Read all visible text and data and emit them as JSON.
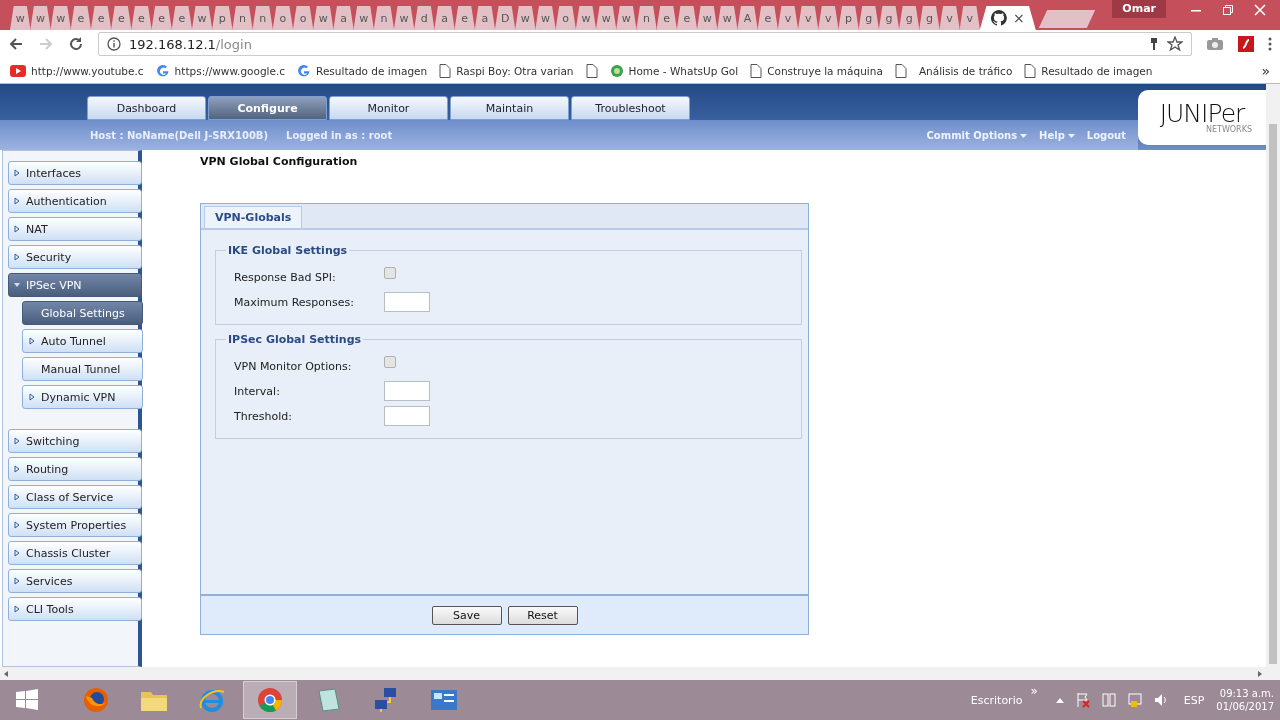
{
  "browser": {
    "tabs": [
      {
        "label": "w",
        "selected": false
      },
      {
        "label": "w",
        "selected": false
      },
      {
        "label": "w",
        "selected": false
      },
      {
        "label": "e",
        "selected": false
      },
      {
        "label": "e",
        "selected": false
      },
      {
        "label": "e",
        "selected": false
      },
      {
        "label": "e",
        "selected": false
      },
      {
        "label": "e",
        "selected": false
      },
      {
        "label": "e",
        "selected": false
      },
      {
        "label": "w",
        "selected": false
      },
      {
        "label": "p",
        "selected": false
      },
      {
        "label": "n",
        "selected": false
      },
      {
        "label": "n",
        "selected": false
      },
      {
        "label": "o",
        "selected": false
      },
      {
        "label": "o",
        "selected": false
      },
      {
        "label": "w",
        "selected": false
      },
      {
        "label": "a",
        "selected": false
      },
      {
        "label": "w",
        "selected": false
      },
      {
        "label": "n",
        "selected": false
      },
      {
        "label": "w",
        "selected": false
      },
      {
        "label": "d",
        "selected": false
      },
      {
        "label": "a",
        "selected": false
      },
      {
        "label": "e",
        "selected": false
      },
      {
        "label": "a",
        "selected": false
      },
      {
        "label": "D",
        "selected": false
      },
      {
        "label": "w",
        "selected": false
      },
      {
        "label": "w",
        "selected": false
      },
      {
        "label": "o",
        "selected": false
      },
      {
        "label": "w",
        "selected": false
      },
      {
        "label": "w",
        "selected": false
      },
      {
        "label": "w",
        "selected": false
      },
      {
        "label": "n",
        "selected": false
      },
      {
        "label": "e",
        "selected": false
      },
      {
        "label": "e",
        "selected": false
      },
      {
        "label": "w",
        "selected": false
      },
      {
        "label": "w",
        "selected": false
      },
      {
        "label": "A",
        "selected": false
      },
      {
        "label": "e",
        "selected": false
      },
      {
        "label": "v",
        "selected": false
      },
      {
        "label": "v",
        "selected": false
      },
      {
        "label": "v",
        "selected": false
      },
      {
        "label": "p",
        "selected": false
      },
      {
        "label": "g",
        "selected": false
      },
      {
        "label": "g",
        "selected": false
      },
      {
        "label": "g",
        "selected": false
      },
      {
        "label": "g",
        "selected": false
      },
      {
        "label": "v",
        "selected": false
      },
      {
        "label": "v",
        "selected": false
      },
      {
        "kind": "github",
        "selected": true
      }
    ],
    "tab_close": "×",
    "profile": "Omar",
    "address": {
      "host": "192.168.12.1",
      "path": "/login"
    },
    "bookmarks": [
      {
        "label": "http://www.youtube.c",
        "kind": "youtube"
      },
      {
        "label": "https://www.google.c",
        "kind": "google"
      },
      {
        "label": "Resultado de imagen",
        "kind": "google"
      },
      {
        "label": "Raspi Boy: Otra varian",
        "kind": "page"
      },
      {
        "kind": "page"
      },
      {
        "label": "Home - WhatsUp Gol",
        "kind": "dot"
      },
      {
        "label": "Construye la máquina",
        "kind": "page"
      },
      {
        "kind": "page"
      },
      {
        "label": "Análisis de tráfico",
        "kind": "plain"
      },
      {
        "label": "Resultado de imagen",
        "kind": "page"
      }
    ],
    "bookmarks_more": "»"
  },
  "app": {
    "nav_tabs": [
      {
        "label": "Dashboard",
        "selected": false
      },
      {
        "label": "Configure",
        "selected": true
      },
      {
        "label": "Monitor",
        "selected": false
      },
      {
        "label": "Maintain",
        "selected": false
      },
      {
        "label": "Troubleshoot",
        "selected": false
      }
    ],
    "host_info": "Host : NoName(Dell J-SRX100B)",
    "login_info": "Logged in as : root",
    "top_links": [
      {
        "label": "Commit Options",
        "menu": true
      },
      {
        "label": "Help",
        "menu": true
      },
      {
        "label": "Logout",
        "menu": false
      }
    ],
    "logo": {
      "name": "JUNIPer",
      "sub": "NETWORKS"
    },
    "sidebar": [
      {
        "label": "Interfaces",
        "expanded": false,
        "selected": false,
        "arrow": true
      },
      {
        "label": "Authentication",
        "expanded": false,
        "selected": false,
        "arrow": true
      },
      {
        "label": "NAT",
        "expanded": false,
        "selected": false,
        "arrow": true
      },
      {
        "label": "Security",
        "expanded": false,
        "selected": false,
        "arrow": true
      },
      {
        "label": "IPSec VPN",
        "expanded": true,
        "selected": true,
        "arrow": true,
        "children": [
          {
            "label": "Global Settings",
            "expanded": false,
            "selected": true,
            "arrow": false
          },
          {
            "label": "Auto Tunnel",
            "expanded": false,
            "selected": false,
            "arrow": true
          },
          {
            "label": "Manual Tunnel",
            "expanded": false,
            "selected": false,
            "arrow": false
          },
          {
            "label": "Dynamic VPN",
            "expanded": false,
            "selected": false,
            "arrow": true
          }
        ]
      },
      {
        "label": "Switching",
        "expanded": false,
        "selected": false,
        "arrow": true
      },
      {
        "label": "Routing",
        "expanded": false,
        "selected": false,
        "arrow": true
      },
      {
        "label": "Class of Service",
        "expanded": false,
        "selected": false,
        "arrow": true
      },
      {
        "label": "System Properties",
        "expanded": false,
        "selected": false,
        "arrow": true
      },
      {
        "label": "Chassis Cluster",
        "expanded": false,
        "selected": false,
        "arrow": true
      },
      {
        "label": "Services",
        "expanded": false,
        "selected": false,
        "arrow": true
      },
      {
        "label": "CLI Tools",
        "expanded": false,
        "selected": false,
        "arrow": true
      }
    ],
    "page_title": "VPN Global Configuration",
    "panel_tab": "VPN-Globals",
    "fieldsets": [
      {
        "legend": "IKE Global Settings",
        "fields": [
          {
            "label": "Response Bad SPI:",
            "kind": "checkbox",
            "checked": false
          },
          {
            "label": "Maximum Responses:",
            "kind": "text"
          }
        ]
      },
      {
        "legend": "IPSec Global Settings",
        "fields": [
          {
            "label": "VPN Monitor Options:",
            "kind": "checkbox",
            "checked": false
          },
          {
            "label": "Interval:",
            "kind": "text"
          },
          {
            "label": "Threshold:",
            "kind": "text"
          }
        ]
      }
    ],
    "buttons": [
      "Save",
      "Reset"
    ]
  },
  "taskbar": {
    "apps": [
      {
        "kind": "firefox",
        "selected": false
      },
      {
        "kind": "folder",
        "selected": false
      },
      {
        "kind": "ie",
        "selected": false
      },
      {
        "kind": "chrome",
        "selected": true
      },
      {
        "kind": "notes",
        "selected": false
      },
      {
        "kind": "network",
        "selected": false
      },
      {
        "kind": "panel",
        "selected": false
      }
    ],
    "desktop_label": "Escritorio",
    "more": "»",
    "language": "ESP",
    "time": "09:13 a.m.",
    "date": "01/06/2017"
  }
}
